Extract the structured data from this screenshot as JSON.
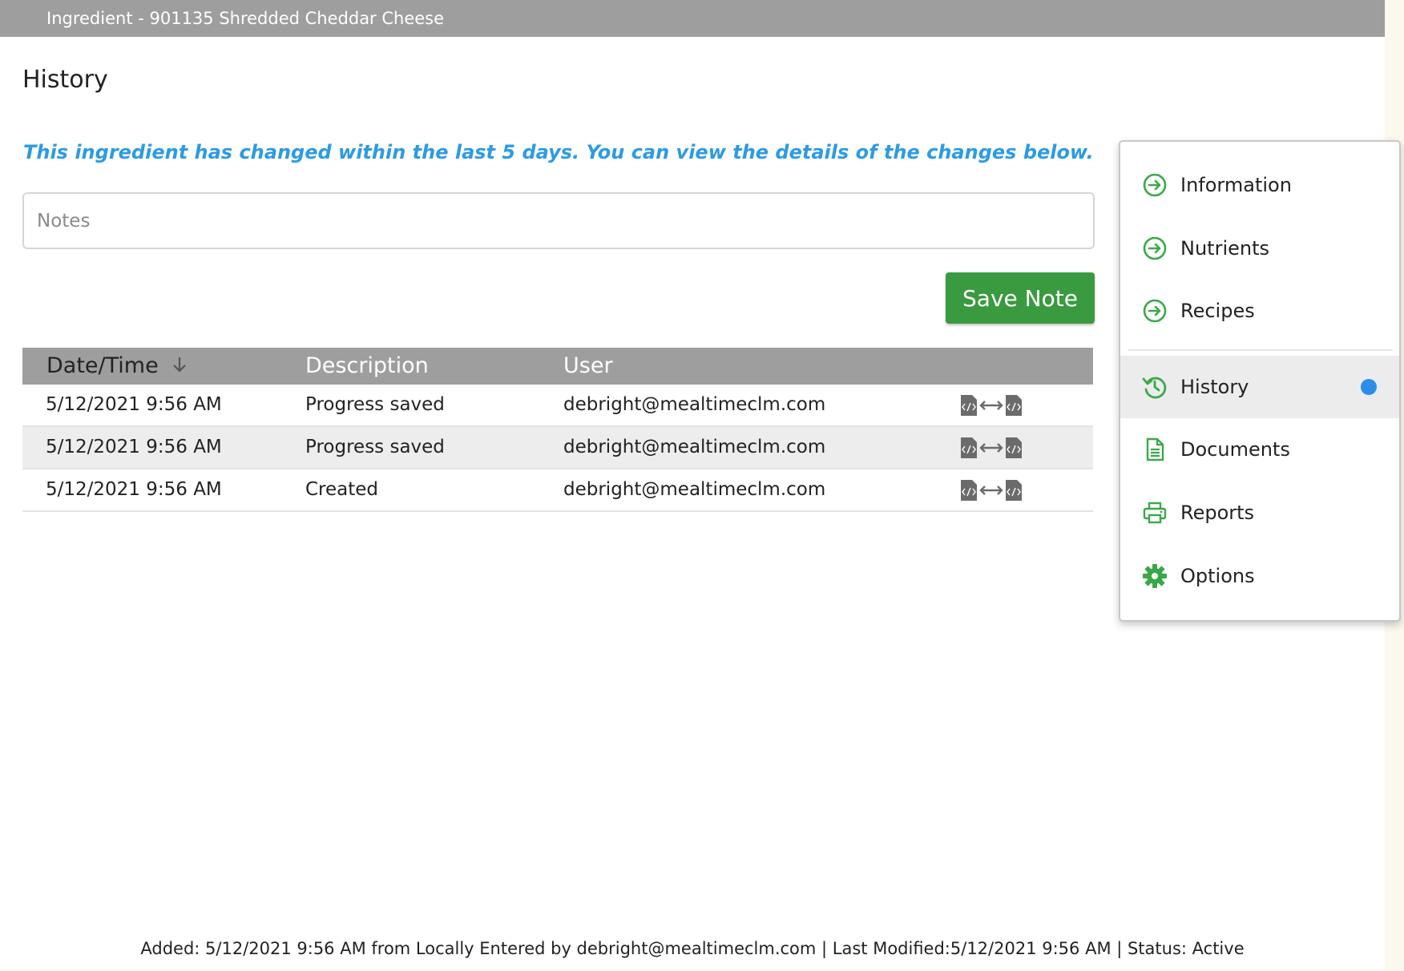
{
  "window": {
    "title": "Ingredient - 901135 Shredded Cheddar Cheese"
  },
  "page": {
    "title": "History",
    "notice": "This ingredient has changed within the last 5 days. You can view the details of the changes below."
  },
  "notes": {
    "placeholder": "Notes",
    "value": ""
  },
  "save_button": {
    "label": "Save Note"
  },
  "table": {
    "headers": {
      "date": "Date/Time",
      "description": "Description",
      "user": "User"
    },
    "rows": [
      {
        "date": "5/12/2021 9:56 AM",
        "description": "Progress saved",
        "user": "debright@mealtimeclm.com"
      },
      {
        "date": "5/12/2021 9:56 AM",
        "description": "Progress saved",
        "user": "debright@mealtimeclm.com"
      },
      {
        "date": "5/12/2021 9:56 AM",
        "description": "Created",
        "user": "debright@mealtimeclm.com"
      }
    ]
  },
  "menu": {
    "items": [
      {
        "label": "Information",
        "icon": "arrow-circle-right-icon"
      },
      {
        "label": "Nutrients",
        "icon": "arrow-circle-right-icon"
      },
      {
        "label": "Recipes",
        "icon": "arrow-circle-right-icon"
      },
      {
        "label": "History",
        "icon": "history-icon",
        "active": true
      },
      {
        "label": "Documents",
        "icon": "document-icon"
      },
      {
        "label": "Reports",
        "icon": "printer-icon"
      },
      {
        "label": "Options",
        "icon": "gear-icon"
      }
    ]
  },
  "footer": {
    "text": "Added: 5/12/2021 9:56 AM from Locally Entered by debright@mealtimeclm.com | Last Modified:5/12/2021 9:56 AM | Status: Active"
  },
  "colors": {
    "titlebar": "#9e9e9e",
    "notice": "#2d9be3",
    "save_button": "#3a9a3f",
    "menu_icon": "#3aa84a",
    "active_dot": "#2d8eea"
  }
}
